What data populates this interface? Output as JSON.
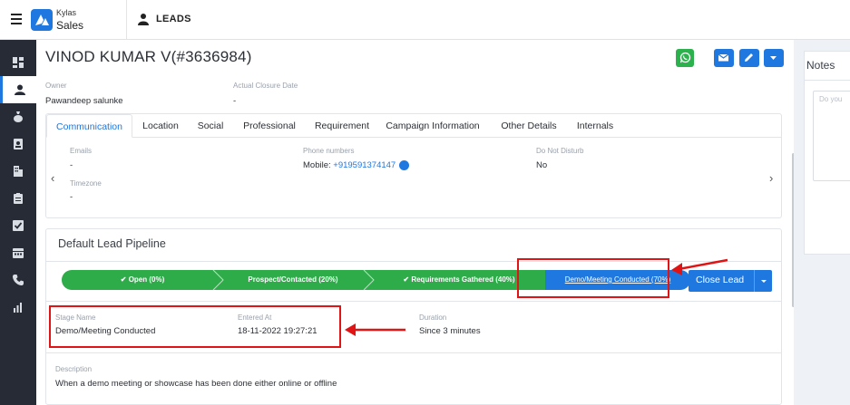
{
  "app": {
    "brand_line1": "Kylas",
    "brand_line2": "Sales",
    "section": "LEADS"
  },
  "lead": {
    "name": "VINOD KUMAR V(#3636984)",
    "owner_label": "Owner",
    "owner_value": "Pawandeep salunke",
    "closure_label": "Actual Closure Date",
    "closure_value": "-"
  },
  "tabs": [
    {
      "label": "Communication"
    },
    {
      "label": "Location"
    },
    {
      "label": "Social"
    },
    {
      "label": "Professional"
    },
    {
      "label": "Requirement"
    },
    {
      "label": "Campaign Information"
    },
    {
      "label": "Other Details"
    },
    {
      "label": "Internals"
    }
  ],
  "communication": {
    "emails_label": "Emails",
    "emails_value": "-",
    "phone_label": "Phone numbers",
    "phone_prefix": "Mobile: ",
    "phone_value": "+919591374147",
    "dnd_label": "Do Not Disturb",
    "dnd_value": "No",
    "timezone_label": "Timezone",
    "timezone_value": "-"
  },
  "pipeline": {
    "title": "Default Lead Pipeline",
    "stages": [
      {
        "label": "Open (0%)",
        "check": true
      },
      {
        "label": "Prospect/Contacted (20%)",
        "check": false
      },
      {
        "label": "Requirements Gathered (40%)",
        "check": true
      }
    ],
    "current_stage": "Demo/Meeting Conducted (70%)",
    "close_button": "Close Lead"
  },
  "stage_details": {
    "stage_name_label": "Stage Name",
    "stage_name_value": "Demo/Meeting Conducted",
    "entered_at_label": "Entered At",
    "entered_at_value": "18-11-2022 19:27:21",
    "duration_label": "Duration",
    "duration_value": "Since 3 minutes",
    "description_label": "Description",
    "description_value": "When a demo meeting or showcase has been done either online or offline"
  },
  "notes": {
    "title": "Notes",
    "placeholder": "Do you"
  },
  "colors": {
    "primary": "#1f78e0",
    "success": "#2eac4a",
    "annotation": "#e01414",
    "sidebar": "#262b36"
  },
  "icons": [
    "menu-icon",
    "person-icon",
    "dashboard-icon",
    "money-bag-icon",
    "contact-card-icon",
    "building-icon",
    "clipboard-icon",
    "checkbox-icon",
    "calendar-icon",
    "phone-icon",
    "reports-icon",
    "whatsapp-icon",
    "email-icon",
    "edit-icon",
    "caret-down-icon"
  ]
}
